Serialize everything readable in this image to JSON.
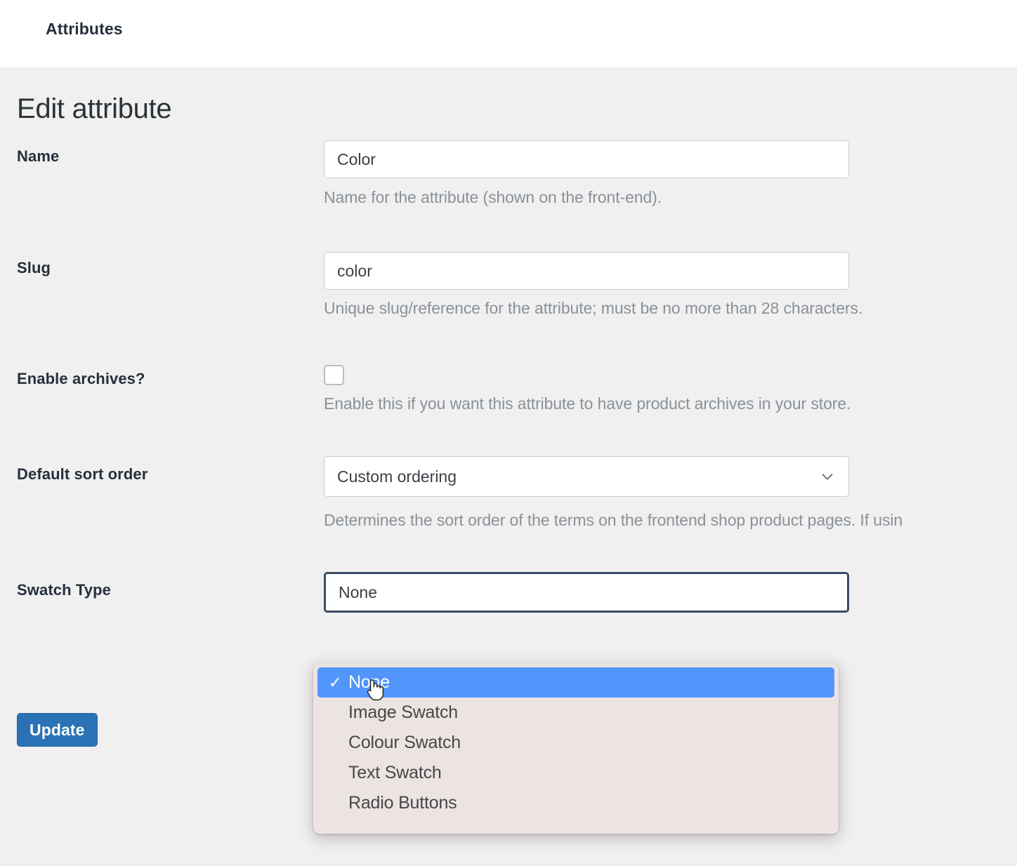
{
  "topbar": {
    "title": "Attributes"
  },
  "page": {
    "title": "Edit attribute"
  },
  "form": {
    "rows": [
      {
        "label": "Name",
        "value": "Color",
        "placeholder": "",
        "help": "Name for the attribute (shown on the front-end)."
      },
      {
        "label": "Slug",
        "value": "color",
        "placeholder": "",
        "help": "Unique slug/reference for the attribute; must be no more than 28 characters."
      },
      {
        "label": "Enable archives?",
        "checked": false,
        "help": "Enable this if you want this attribute to have product archives in your store."
      },
      {
        "label": "Default sort order",
        "value": "Custom ordering",
        "help": "Determines the sort order of the terms on the frontend shop product pages. If usin"
      },
      {
        "label": "Swatch Type",
        "value": "None"
      }
    ]
  },
  "dropdown": {
    "open": true,
    "selected_index": 0,
    "check_glyph": "✓",
    "items": [
      {
        "label": "None"
      },
      {
        "label": "Image Swatch"
      },
      {
        "label": "Colour Swatch"
      },
      {
        "label": "Text Swatch"
      },
      {
        "label": "Radio Buttons"
      }
    ]
  },
  "actions": {
    "update_label": "Update"
  },
  "colors": {
    "page_background": "#f0f0f0",
    "topbar_background": "#ffffff",
    "accent_button": "#2a72b5",
    "dropdown_background": "#ece3e3",
    "dropdown_highlight": "#5296fb",
    "focus_border": "#3b4b63",
    "help_text": "#8a9199",
    "label_text": "#26303d"
  }
}
